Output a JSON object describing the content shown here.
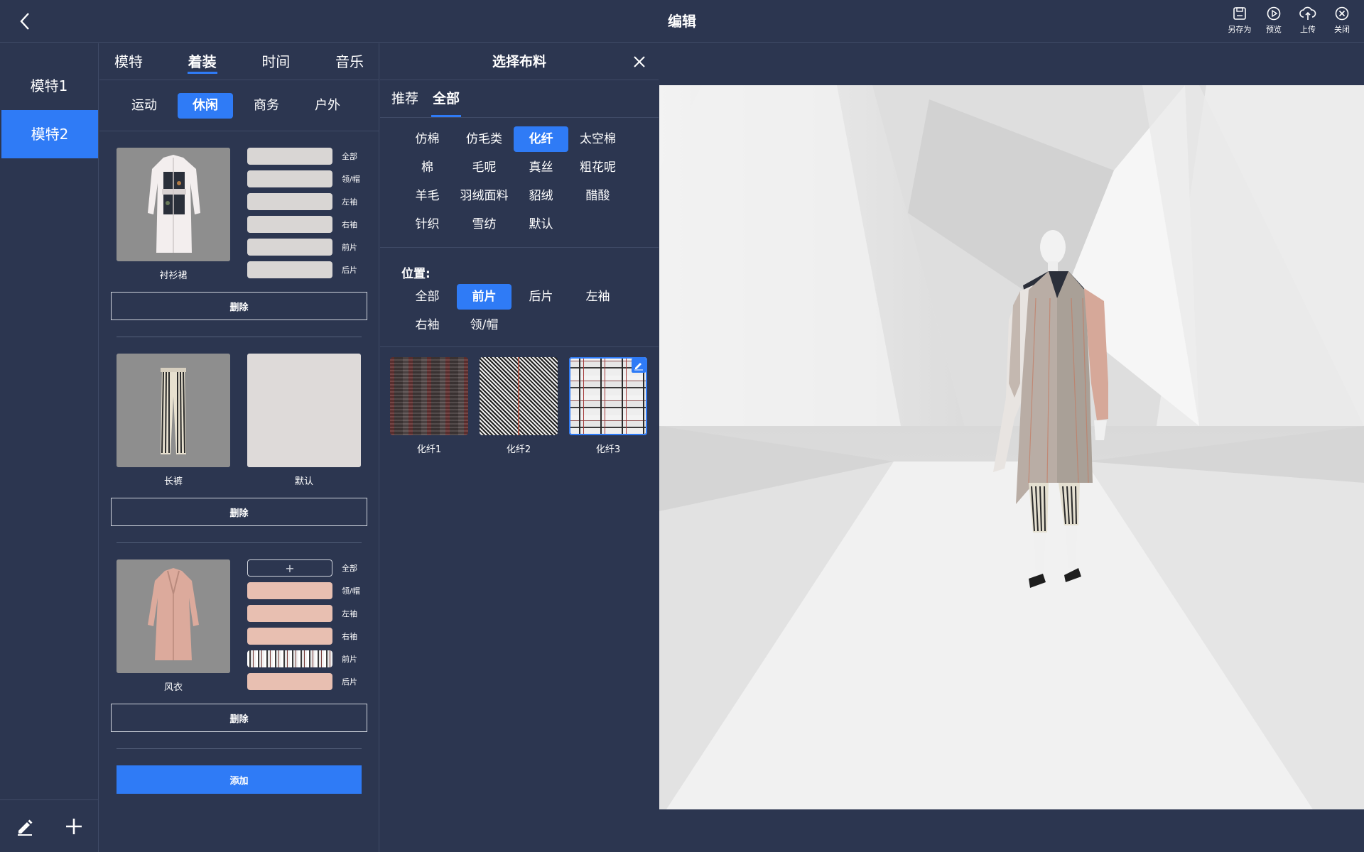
{
  "header": {
    "title": "编辑",
    "actions": [
      {
        "label": "另存为",
        "icon": "save-icon"
      },
      {
        "label": "预览",
        "icon": "play-icon"
      },
      {
        "label": "上传",
        "icon": "cloud-upload-icon"
      },
      {
        "label": "关闭",
        "icon": "close-circle-icon"
      }
    ]
  },
  "models": {
    "items": [
      {
        "label": "模特1"
      },
      {
        "label": "模特2"
      }
    ],
    "active_index": 1
  },
  "dress_panel": {
    "tabs": [
      {
        "label": "模特"
      },
      {
        "label": "着装"
      },
      {
        "label": "时间"
      },
      {
        "label": "音乐"
      }
    ],
    "active_tab": 1,
    "categories": [
      {
        "label": "运动"
      },
      {
        "label": "休闲"
      },
      {
        "label": "商务"
      },
      {
        "label": "户外"
      }
    ],
    "active_category": 1,
    "garments": [
      {
        "name": "衬衫裙",
        "parts": [
          {
            "label": "全部"
          },
          {
            "label": "领/帽"
          },
          {
            "label": "左袖"
          },
          {
            "label": "右袖"
          },
          {
            "label": "前片"
          },
          {
            "label": "后片"
          }
        ],
        "delete_label": "删除"
      },
      {
        "name": "长裤",
        "secondary_name": "默认",
        "delete_label": "删除"
      },
      {
        "name": "风衣",
        "parts": [
          {
            "label": "全部",
            "add_glyph": "+"
          },
          {
            "label": "领/帽"
          },
          {
            "label": "左袖"
          },
          {
            "label": "右袖"
          },
          {
            "label": "前片"
          },
          {
            "label": "后片"
          }
        ],
        "delete_label": "删除"
      }
    ],
    "add_label": "添加"
  },
  "fabric_panel": {
    "title": "选择布料",
    "tabs": [
      {
        "label": "推荐"
      },
      {
        "label": "全部"
      }
    ],
    "active_tab": 1,
    "types": [
      "仿棉",
      "仿毛类",
      "化纤",
      "太空棉",
      "棉",
      "毛呢",
      "真丝",
      "粗花呢",
      "羊毛",
      "羽绒面料",
      "貂绒",
      "醋酸",
      "针织",
      "雪纺",
      "默认"
    ],
    "active_type": 2,
    "position_label": "位置:",
    "positions": [
      "全部",
      "前片",
      "后片",
      "左袖",
      "右袖",
      "领/帽"
    ],
    "active_position": 1,
    "swatches": [
      {
        "name": "化纤1"
      },
      {
        "name": "化纤2"
      },
      {
        "name": "化纤3",
        "selected": true
      }
    ]
  },
  "colors": {
    "background": "#2c3650",
    "accent": "#2f7bf6",
    "divider": "#3f4a66"
  }
}
